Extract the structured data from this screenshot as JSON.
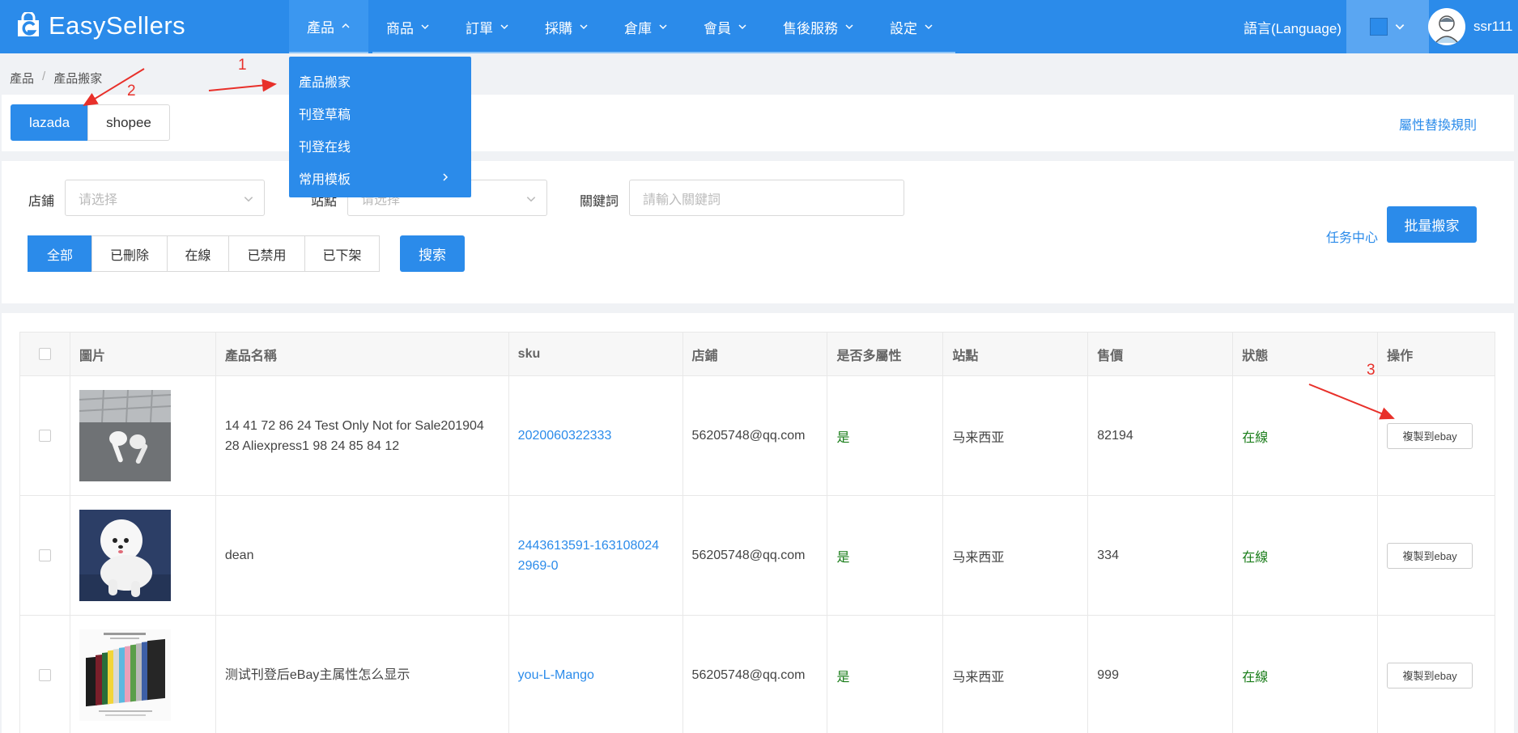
{
  "app": {
    "brand": "EasySellers"
  },
  "nav": {
    "items": [
      {
        "label": "產品",
        "active": true
      },
      {
        "label": "商品"
      },
      {
        "label": "訂單"
      },
      {
        "label": "採購"
      },
      {
        "label": "倉庫"
      },
      {
        "label": "會員"
      },
      {
        "label": "售後服務"
      },
      {
        "label": "設定"
      }
    ],
    "language": "語言(Language)",
    "username": "ssr111"
  },
  "dropdown": {
    "items": [
      {
        "label": "產品搬家"
      },
      {
        "label": "刊登草稿"
      },
      {
        "label": "刊登在线"
      },
      {
        "label": "常用模板",
        "has_submenu": true
      }
    ]
  },
  "breadcrumb": {
    "items": [
      "產品",
      "產品搬家"
    ],
    "separator": "/"
  },
  "annotations": [
    "1",
    "2",
    "3"
  ],
  "platforms": {
    "items": [
      "lazada",
      "shopee"
    ],
    "selected": "lazada",
    "attr_rule_link": "屬性替換規則"
  },
  "filters": {
    "store_label": "店鋪",
    "store_placeholder": "请选择",
    "site_label": "站點",
    "site_placeholder": "请选择",
    "keyword_label": "關鍵詞",
    "keyword_placeholder": "請輸入關鍵詞",
    "status_tabs": [
      "全部",
      "已刪除",
      "在線",
      "已禁用",
      "已下架"
    ],
    "status_selected": "全部",
    "search_label": "搜索",
    "task_center": "任务中心",
    "batch_move": "批量搬家"
  },
  "table": {
    "columns": [
      "圖片",
      "產品名稱",
      "sku",
      "店鋪",
      "是否多屬性",
      "站點",
      "售價",
      "狀態",
      "操作"
    ],
    "rows": [
      {
        "image": "earbuds-image",
        "name": "14 41 72 86 24 Test Only Not for Sale20190428 Aliexpress1 98 24 85 84 12",
        "name_line1": "14 41 72 86 24 Test Only Not for Sale201904",
        "name_line2": "28 Aliexpress1 98 24 85 84 12",
        "sku_line1": "2020060322333",
        "sku_line2": "",
        "store": "56205748@qq.com",
        "multi_attr": "是",
        "site": "马来西亚",
        "price": "82194",
        "status": "在線",
        "action": "複製到ebay"
      },
      {
        "image": "white-dog-image",
        "name": "dean",
        "name_line1": "dean",
        "name_line2": "",
        "sku_line1": "2443613591-163108024",
        "sku_line2": "2969-0",
        "store": "56205748@qq.com",
        "multi_attr": "是",
        "site": "马来西亚",
        "price": "334",
        "status": "在線",
        "action": "複製到ebay"
      },
      {
        "image": "colored-folders-image",
        "name": "测试刊登后eBay主属性怎么显示",
        "name_line1": "测试刊登后eBay主属性怎么显示",
        "name_line2": "",
        "sku_line1": "you-L-Mango",
        "sku_line2": "",
        "store": "56205748@qq.com",
        "multi_attr": "是",
        "site": "马来西亚",
        "price": "999",
        "status": "在線",
        "action": "複製到ebay"
      }
    ]
  },
  "colors": {
    "primary": "#2b8bea",
    "success": "#1a7d1a",
    "annotation": "#e8302a"
  }
}
